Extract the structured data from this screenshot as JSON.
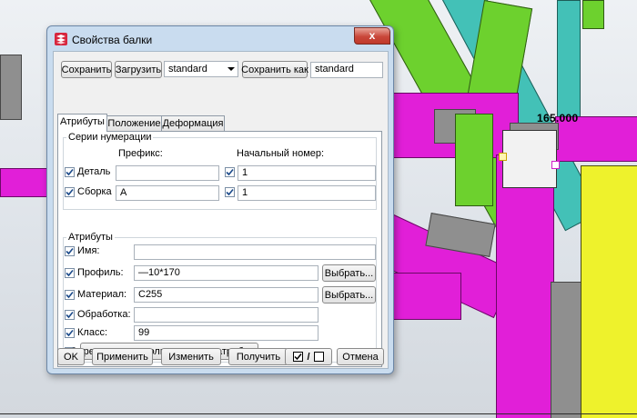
{
  "viewport": {
    "dimension_label": "165.000"
  },
  "dialog": {
    "title": "Свойства балки",
    "close_symbol": "x",
    "toolbar": {
      "save_label": "Сохранить",
      "load_label": "Загрузить",
      "preset_value": "standard",
      "save_as_label": "Сохранить как",
      "save_as_value": "standard"
    },
    "tabs": [
      {
        "label": "Атрибуты",
        "active": true
      },
      {
        "label": "Положение",
        "active": false
      },
      {
        "label": "Деформация",
        "active": false
      }
    ],
    "numbering": {
      "group_title": "Серии нумерации",
      "prefix_header": "Префикс:",
      "start_header": "Начальный номер:",
      "rows": [
        {
          "label": "Деталь",
          "checked": true,
          "prefix": "",
          "start_checked": true,
          "start": "1"
        },
        {
          "label": "Сборка",
          "checked": true,
          "prefix": "A",
          "start_checked": true,
          "start": "1"
        }
      ]
    },
    "attributes": {
      "group_title": "Атрибуты",
      "name_label": "Имя:",
      "name_value": "",
      "profile_label": "Профиль:",
      "profile_value": "—10*170",
      "material_label": "Материал:",
      "material_value": "C255",
      "finish_label": "Обработка:",
      "finish_value": "",
      "class_label": "Класс:",
      "class_value": "99",
      "select_label": "Выбрать...",
      "udf_label": "Определенные пользователем атрибуты..."
    },
    "footer": {
      "ok_label": "OK",
      "apply_label": "Применить",
      "modify_label": "Изменить",
      "get_label": "Получить",
      "toggle_text": "/",
      "cancel_label": "Отмена"
    }
  }
}
